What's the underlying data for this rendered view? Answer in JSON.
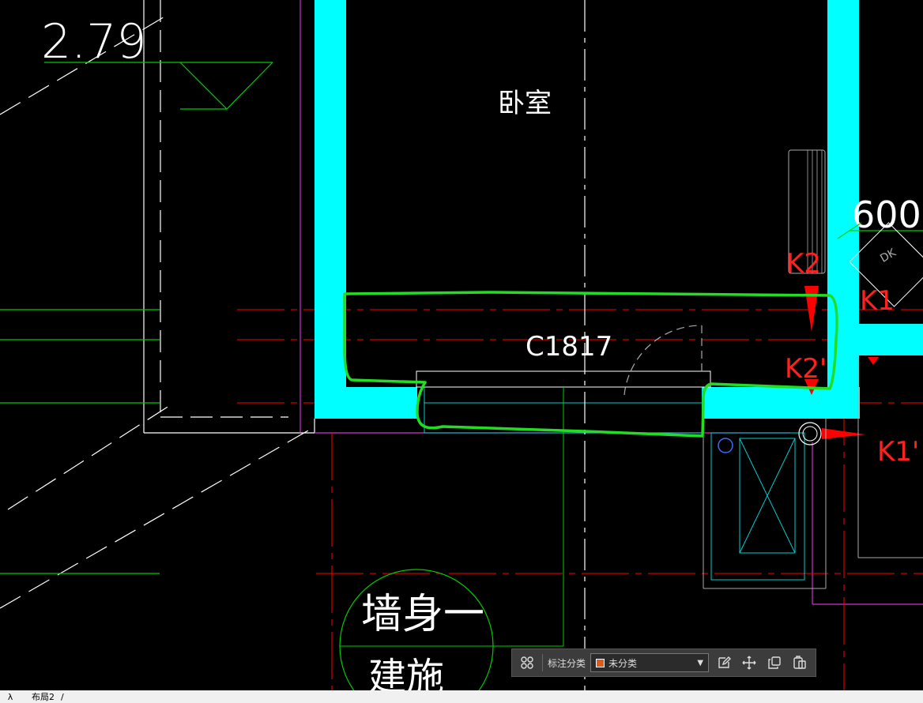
{
  "drawing": {
    "texts": {
      "elevation": "2.79",
      "room_name": "卧室",
      "window_code": "C1817",
      "dimension": "600",
      "k2_upper": "K2",
      "k2_lower": "K2'",
      "k1_upper": "K1",
      "k1_lower": "K1'",
      "dk": "DK",
      "bubble_line1": "墙身一",
      "bubble_line2": "建施"
    },
    "colors": {
      "wall": "#00ffff",
      "axis": "#ff0000",
      "markup": "#22dd22",
      "line": "#ffffff",
      "green": "#00cc00",
      "magenta": "#cc33cc"
    }
  },
  "toolbar": {
    "category_label": "标注分类",
    "category_value": "未分类",
    "category_color": "#e05a1a",
    "icons": [
      "group-icon",
      "edit-icon",
      "move-icon",
      "copy-icon",
      "paste-icon"
    ]
  },
  "layout_tabs": {
    "nav_glyph": "λ",
    "active_tab": "布局2",
    "trail": "/"
  }
}
